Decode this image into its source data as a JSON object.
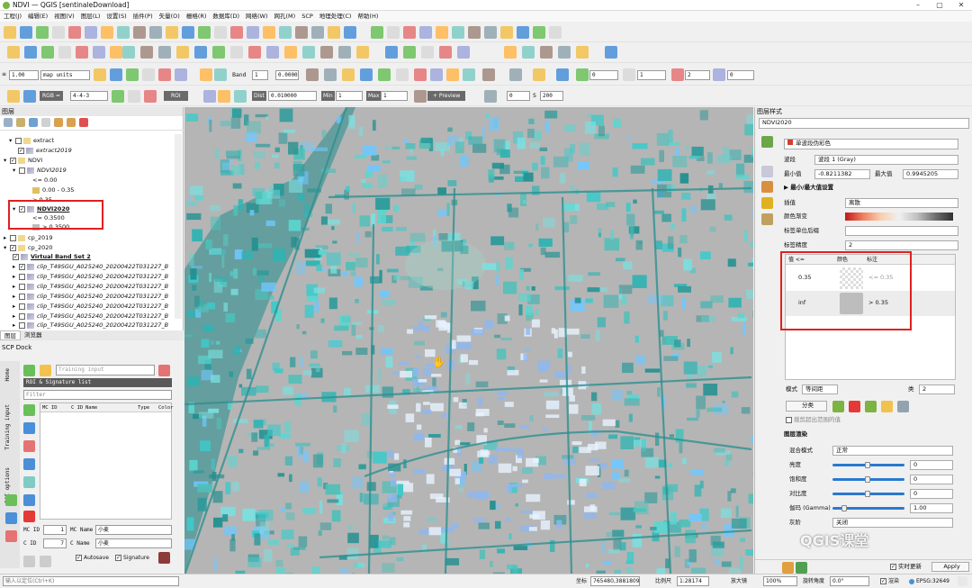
{
  "window": {
    "title": "NDVI — QGIS [sentinaleDownload]"
  },
  "menu": [
    "工程(J)",
    "编辑(E)",
    "视图(V)",
    "图层(L)",
    "设置(S)",
    "插件(P)",
    "矢量(O)",
    "栅格(R)",
    "数据库(D)",
    "网络(W)",
    "网孔(M)",
    "SCP",
    "地理处理(C)",
    "帮助(H)"
  ],
  "toolbar3": {
    "line_width": "1.00",
    "units": "map units",
    "band_label": "Band",
    "band_value": "1",
    "field_value": "0.0000",
    "spin1": "0",
    "spin2": "1",
    "spin3": "2",
    "spin4": "0"
  },
  "toolbar4": {
    "rgb": "RGB = ",
    "rgb_value": "4-4-3",
    "roi": "ROI",
    "dist_label": "Dist",
    "dist_value": "0.010000",
    "min_label": "Min",
    "min_value": "1",
    "max_label": "Max",
    "max_value": "1",
    "preview": "+ Preview",
    "t_value": "0",
    "s_label": "S",
    "s_value": "200"
  },
  "layers_panel": {
    "title": "图层",
    "items": [
      {
        "label": "extract"
      },
      {
        "label": "extract2019"
      },
      {
        "label": "NDVI"
      },
      {
        "label": "NDVI2019"
      },
      {
        "label": "<= 0.00"
      },
      {
        "label": "0.00 - 0.35"
      },
      {
        "label": "> 0.35"
      },
      {
        "label": "NDVI2020"
      },
      {
        "label": "<= 0.3500"
      },
      {
        "label": "> 0.3500"
      },
      {
        "label": "cp_2019"
      },
      {
        "label": "cp_2020"
      },
      {
        "label": "Virtual Band Set 2"
      },
      {
        "label": "clip_T49SGU_A025240_20200422T031227_B"
      },
      {
        "label": "clip_T49SGU_A025240_20200422T031227_B"
      },
      {
        "label": "clip_T49SGU_A025240_20200422T031227_B"
      },
      {
        "label": "clip_T49SGU_A025240_20200422T031227_B"
      },
      {
        "label": "clip_T49SGU_A025240_20200422T031227_B"
      },
      {
        "label": "clip_T49SGU_A025240_20200422T031227_B"
      },
      {
        "label": "clip_T49SGU_A025240_20200422T031227_B"
      }
    ],
    "tabs": [
      "图层",
      "浏览器"
    ]
  },
  "scp_dock": {
    "title": "SCP Dock",
    "training_placeholder": "Training input",
    "roi_header": "ROI & Signature list",
    "filter_placeholder": "Filter",
    "columns": [
      "MC ID",
      "C ID",
      "Name",
      "Type",
      "Color"
    ],
    "side_tabs": [
      "Home",
      "Training input",
      "ROI options"
    ],
    "mc_id_label": "MC ID",
    "mc_id": "1",
    "mc_name_label": "MC Name",
    "mc_name": "小麦",
    "c_id_label": "C ID",
    "c_id": "7",
    "c_name_label": "C Name",
    "c_name": "小麦",
    "autosave": "Autosave",
    "signature": "Signature"
  },
  "style_panel": {
    "title": "图层样式",
    "layer": "NDVI2020",
    "renderer": "单波段伪彩色",
    "band_label": "波段",
    "band": "波段 1 (Gray)",
    "min_label": "最小值",
    "min": "-0.8211382",
    "max_label": "最大值",
    "max": "0.9945205",
    "minmax_settings": "最小/最大值设置",
    "interp_label": "插值",
    "interp": "离散",
    "ramp_label": "颜色渐变",
    "unit_label": "标签单位后缀",
    "precision_label": "标签精度",
    "precision": "2",
    "table_headers": [
      "值 <=",
      "颜色",
      "标注"
    ],
    "classes": [
      {
        "value": "0.35",
        "label": "<= 0.35",
        "color": "transparent"
      },
      {
        "value": "inf",
        "label": "> 0.35",
        "color": "#bdbdbd"
      }
    ],
    "mode_label": "模式",
    "mode": "等间距",
    "classes_label": "类",
    "classes_count": "2",
    "classify": "分类",
    "clip_label": "裁剪超出范围的值",
    "render_title": "图层渲染",
    "blend_label": "混合模式",
    "blend": "正常",
    "brightness_label": "亮度",
    "brightness": "0",
    "saturation_label": "饱和度",
    "saturation": "0",
    "contrast_label": "对比度",
    "contrast": "0",
    "gamma_label": "伽玛 (Gamma)",
    "gamma": "1.00",
    "gray_label": "灰阶",
    "gray": "关闭",
    "live_update": "实时更新",
    "apply": "Apply",
    "watermark": "QGIS课堂"
  },
  "status": {
    "search_placeholder": "输入以定位(Ctrl+K)",
    "coord_label": "坐标",
    "coord": "765480,3881809",
    "scale_label": "比例尺",
    "scale": "1:28174",
    "mag_label": "放大镜",
    "mag": "100%",
    "rot_label": "旋转角度",
    "rot": "0.0°",
    "render_label": "渲染",
    "crs": "EPSG:32649"
  },
  "colors": {
    "accent": "#2b78d0",
    "highlight": "#e02020",
    "map_bg": "#b5b5b5",
    "veg": "#3fc9c9"
  }
}
